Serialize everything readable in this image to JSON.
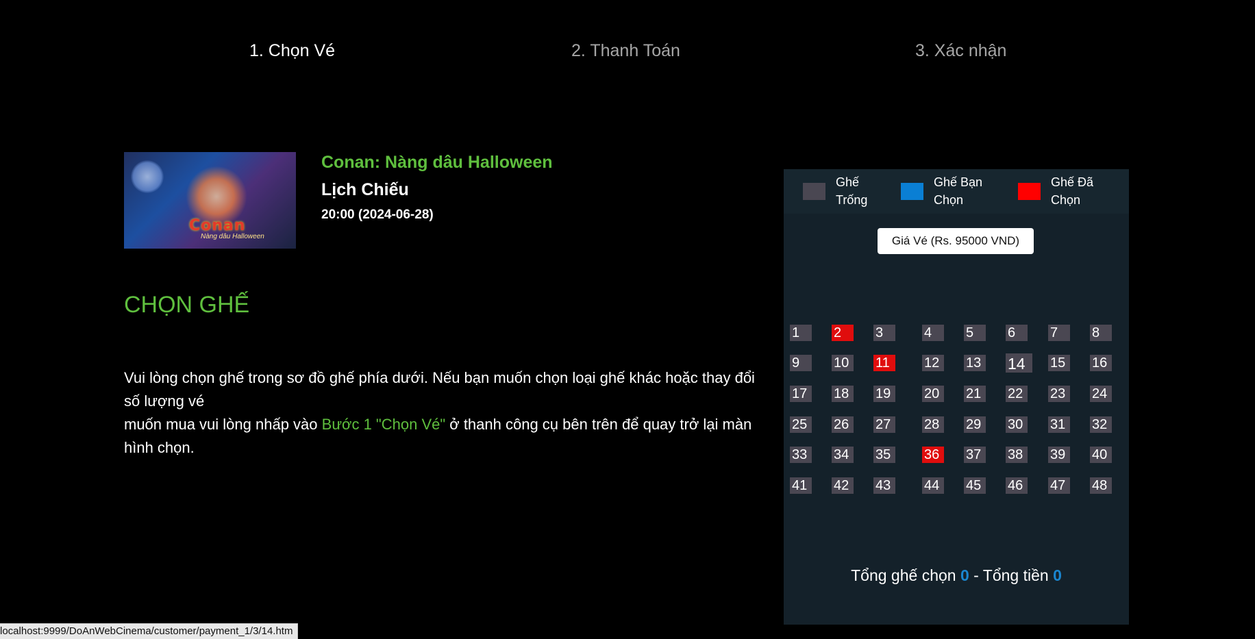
{
  "steps": [
    {
      "label": "1. Chọn Vé"
    },
    {
      "label": "2. Thanh Toán"
    },
    {
      "label": "3. Xác nhận"
    }
  ],
  "movie": {
    "title": "Conan: Nàng dâu Halloween",
    "schedule_label": "Lịch Chiếu",
    "schedule_time": "20:00 (2024-06-28)",
    "poster_logo": "Conan",
    "poster_sub": "Nàng dâu Halloween"
  },
  "choose_heading": "CHỌN GHẾ",
  "instructions": {
    "line1": "Vui lòng chọn ghế trong sơ đồ ghế phía dưới. Nếu bạn muốn chọn loại ghế khác hoặc thay đổi số lượng vé",
    "line2_prefix": "muốn mua vui lòng nhấp vào ",
    "line2_link": "Bước 1 \"Chọn Vé\"",
    "line2_suffix": " ở thanh công cụ bên trên để quay trở lại màn hình chọn."
  },
  "legend": [
    {
      "line1": "Ghế",
      "line2": "Trống",
      "color": "#4a4752"
    },
    {
      "line1": "Ghế Bạn",
      "line2": "Chọn",
      "color": "#0a7fd4"
    },
    {
      "line1": "Ghế Đã",
      "line2": "Chọn",
      "color": "#ff0000"
    }
  ],
  "price_label": "Giá Vé (Rs. 95000 VND)",
  "seats": {
    "labels": [
      "1",
      "2",
      "3",
      "4",
      "5",
      "6",
      "7",
      "8",
      "9",
      "10",
      "11",
      "12",
      "13",
      "14",
      "15",
      "16",
      "17",
      "18",
      "19",
      "20",
      "21",
      "22",
      "23",
      "24",
      "25",
      "26",
      "27",
      "28",
      "29",
      "30",
      "31",
      "32",
      "33",
      "34",
      "35",
      "36",
      "37",
      "38",
      "39",
      "40",
      "41",
      "42",
      "43",
      "44",
      "45",
      "46",
      "47",
      "48"
    ],
    "taken": [
      "2",
      "11",
      "36"
    ],
    "highlighted": [
      "14"
    ]
  },
  "summary": {
    "seats_label": "Tổng ghế chọn",
    "seats_count": "0",
    "separator": " - ",
    "total_label": "Tổng tiền",
    "total_value": "0"
  },
  "status_url": "localhost:9999/DoAnWebCinema/customer/payment_1/3/14.htm"
}
